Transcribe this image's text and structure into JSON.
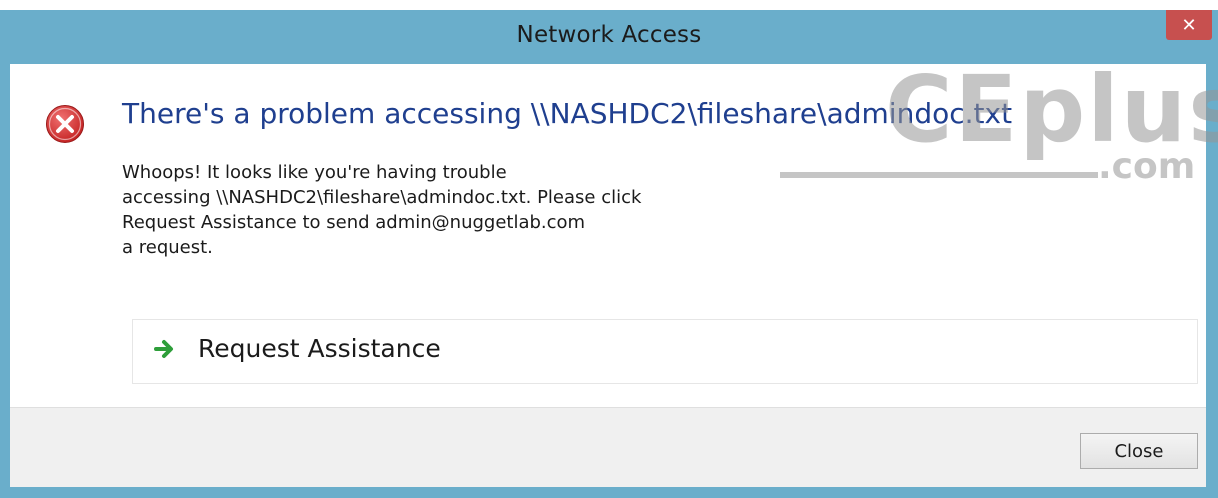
{
  "window": {
    "title": "Network Access",
    "close_glyph": "✕"
  },
  "dialog": {
    "icon": "error-icon",
    "heading": "There's a problem accessing \\\\NASHDC2\\fileshare\\admindoc.txt",
    "message_lines": [
      "Whoops! It looks like you're having trouble",
      "accessing \\\\NASHDC2\\fileshare\\admindoc.txt. Please click",
      "Request Assistance to send admin@nuggetlab.com",
      "a request."
    ],
    "action": {
      "icon": "green-arrow-icon",
      "label": "Request Assistance"
    }
  },
  "footer": {
    "close_label": "Close"
  },
  "watermark": {
    "main": "CEplus",
    "suffix": ".com"
  },
  "colors": {
    "titlebar": "#6aaecb",
    "close_button": "#c7504f",
    "heading": "#1f3f8f",
    "error_red": "#d83a3a",
    "arrow_green": "#2e9e3a"
  }
}
